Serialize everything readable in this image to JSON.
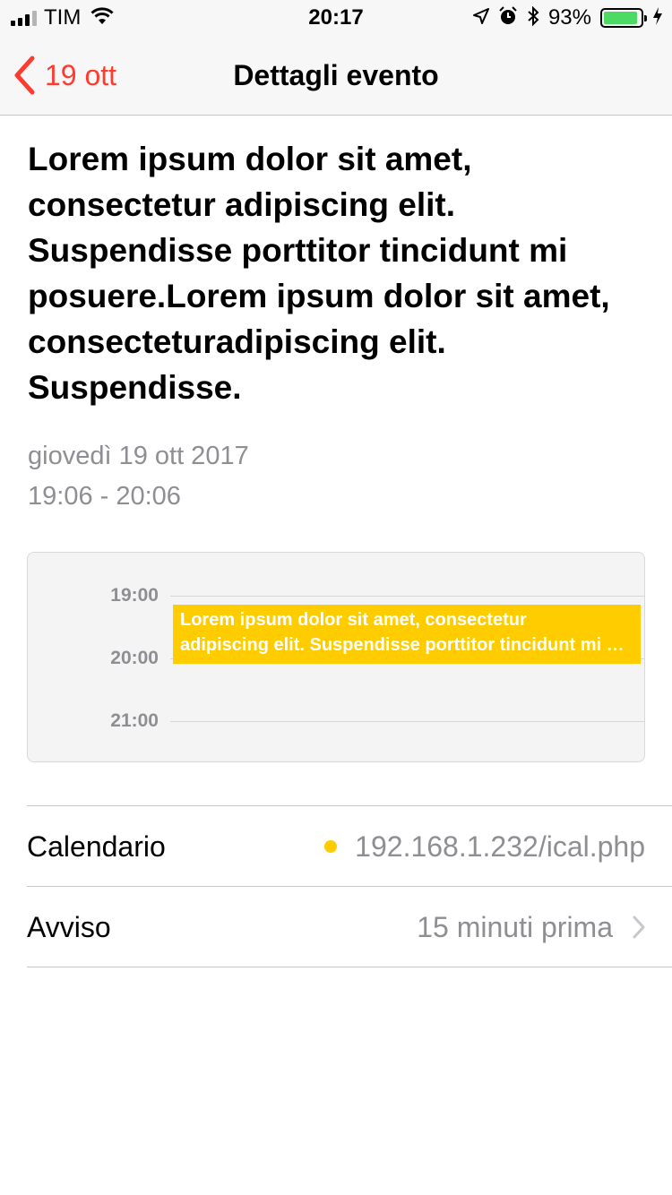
{
  "status_bar": {
    "carrier": "TIM",
    "time": "20:17",
    "battery_percent_label": "93%",
    "battery_level": 0.93,
    "icons": [
      "signal-icon",
      "wifi-icon",
      "location-icon",
      "alarm-icon",
      "bluetooth-icon",
      "battery-icon",
      "charging-icon"
    ]
  },
  "nav": {
    "back_label": "19 ott",
    "title": "Dettagli evento"
  },
  "event": {
    "title": "Lorem ipsum dolor sit amet, consectetur adipiscing elit. Suspendisse porttitor tincidunt mi posuere.Lorem ipsum dolor sit amet, consecteturadipiscing elit. Suspendisse.",
    "date": "giovedì 19 ott 2017",
    "time_range": "19:06 - 20:06"
  },
  "timeline": {
    "hours": [
      "19:00",
      "20:00",
      "21:00"
    ],
    "event_line1": "Lorem ipsum dolor sit amet, consectetur",
    "event_line2": "adipiscing elit. Suspendisse porttitor tincidunt mi posuere.",
    "event_color": "#ffcc00"
  },
  "details": {
    "calendar_label": "Calendario",
    "calendar_value": "192.168.1.232/ical.php",
    "calendar_color": "#ffcc00",
    "alert_label": "Avviso",
    "alert_value": "15 minuti prima"
  },
  "colors": {
    "accent": "#ff3b30",
    "secondary_text": "#8e8e93",
    "battery_fill": "#4cd964"
  }
}
